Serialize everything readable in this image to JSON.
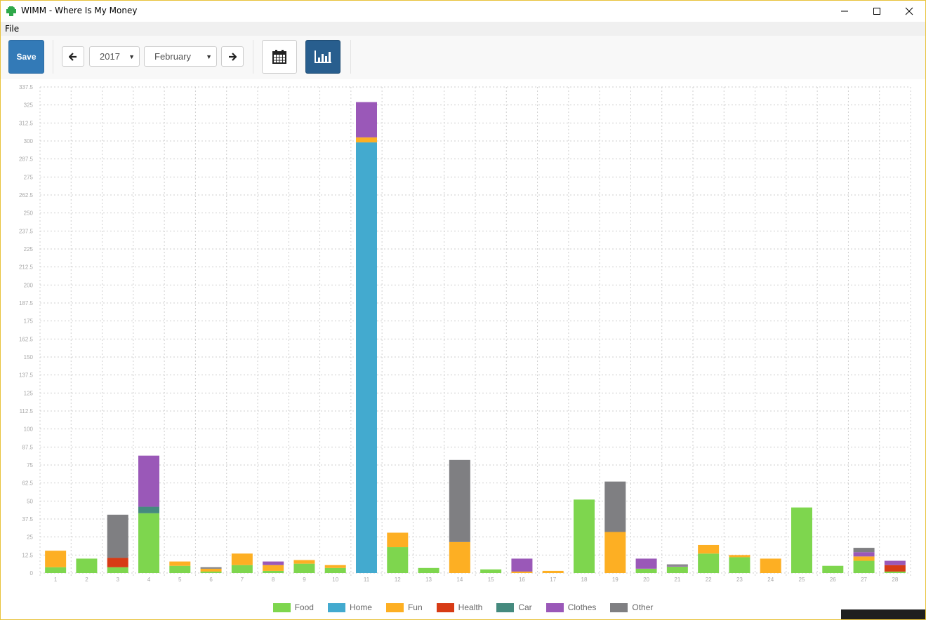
{
  "window": {
    "title": "WIMM - Where Is My Money",
    "controls": {
      "minimize": "minimize",
      "maximize": "maximize",
      "close": "close"
    }
  },
  "menu": {
    "file": "File"
  },
  "toolbar": {
    "save_label": "Save",
    "year": "2017",
    "month": "February",
    "prev_icon": "arrow-left-icon",
    "next_icon": "arrow-right-icon",
    "calendar_view_icon": "calendar-icon",
    "chart_view_icon": "bar-chart-icon"
  },
  "colors": {
    "save": "#337ab7",
    "chart_active": "#285e8e"
  },
  "chart_data": {
    "type": "bar",
    "stacked": true,
    "title": "",
    "xlabel": "",
    "ylabel": "",
    "ylim": [
      0,
      337.5
    ],
    "ytick_step": 12.5,
    "yticks": [
      "0",
      "12.5",
      "25",
      "37.5",
      "50",
      "62.5",
      "75",
      "87.5",
      "100",
      "112.5",
      "125",
      "137.5",
      "150",
      "162.5",
      "175",
      "187.5",
      "200",
      "212.5",
      "225",
      "237.5",
      "250",
      "262.5",
      "275",
      "287.5",
      "300",
      "312.5",
      "325",
      "337.5"
    ],
    "grid": true,
    "legend_position": "bottom",
    "categories": [
      "1",
      "2",
      "3",
      "4",
      "5",
      "6",
      "7",
      "8",
      "9",
      "10",
      "11",
      "12",
      "13",
      "14",
      "15",
      "16",
      "17",
      "18",
      "19",
      "20",
      "21",
      "22",
      "23",
      "24",
      "25",
      "26",
      "27",
      "28"
    ],
    "series": [
      {
        "name": "Food",
        "color": "#7ed64e",
        "values": [
          4,
          10,
          4,
          41.5,
          5,
          1,
          5.5,
          1.5,
          6.5,
          3.5,
          0,
          18,
          3.5,
          0,
          2.5,
          0,
          0,
          51,
          0,
          3,
          4.5,
          13.5,
          11,
          0,
          45.5,
          5,
          8.5,
          1
        ]
      },
      {
        "name": "Home",
        "color": "#43aacf",
        "values": [
          0,
          0,
          0,
          0,
          0,
          0,
          0,
          0,
          0,
          0,
          299,
          0,
          0,
          0,
          0,
          0,
          0,
          0,
          0,
          0,
          0,
          0,
          0,
          0,
          0,
          0,
          0,
          0
        ]
      },
      {
        "name": "Fun",
        "color": "#fdaf23",
        "values": [
          11.5,
          0,
          0,
          0,
          3,
          2,
          8,
          4,
          2.5,
          2,
          3.5,
          10,
          0,
          21.5,
          0,
          1,
          1.5,
          0,
          28.5,
          0,
          0,
          6,
          1.5,
          10,
          0,
          0,
          3,
          0
        ]
      },
      {
        "name": "Health",
        "color": "#d73b15",
        "values": [
          0,
          0,
          6.5,
          0,
          0,
          0,
          0,
          0,
          0,
          0,
          0,
          0,
          0,
          0,
          0,
          0,
          0,
          0,
          0,
          0,
          0,
          0,
          0,
          0,
          0,
          0,
          0,
          4.5
        ]
      },
      {
        "name": "Car",
        "color": "#458a7e",
        "values": [
          0,
          0,
          0,
          4.5,
          0,
          0,
          0,
          0,
          0,
          0,
          0,
          0,
          0,
          0,
          0,
          0,
          0,
          0,
          0,
          0,
          0,
          0,
          0,
          0,
          0,
          0,
          0,
          0
        ]
      },
      {
        "name": "Clothes",
        "color": "#9a58b8",
        "values": [
          0,
          0,
          0,
          35.5,
          0,
          0,
          0,
          2.5,
          0,
          0,
          24.5,
          0,
          0,
          0,
          0,
          9,
          0,
          0,
          0,
          7,
          0.5,
          0,
          0,
          0,
          0,
          0,
          3,
          3
        ]
      },
      {
        "name": "Other",
        "color": "#7f7f82",
        "values": [
          0,
          0,
          30,
          0,
          0,
          1,
          0,
          0,
          0,
          0,
          0,
          0,
          0,
          57,
          0,
          0,
          0,
          0,
          35,
          0,
          1,
          0,
          0,
          0,
          0,
          0,
          3,
          0
        ]
      }
    ]
  }
}
